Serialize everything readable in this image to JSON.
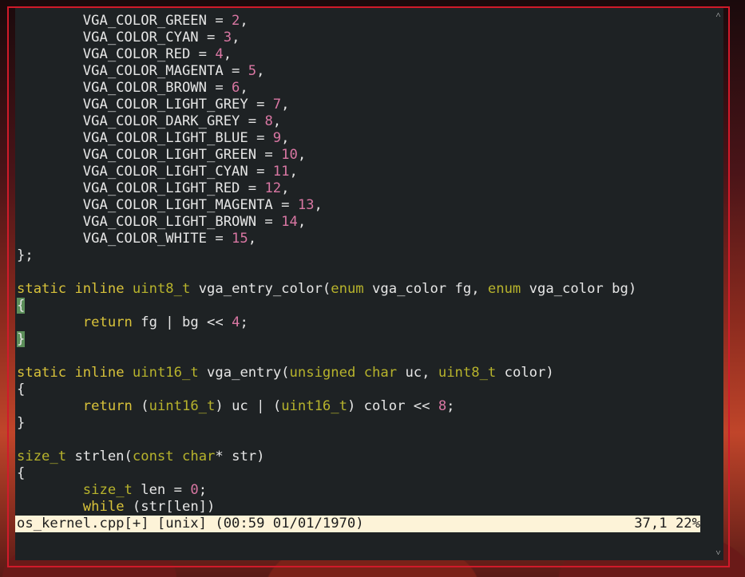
{
  "editor": {
    "code_lines": [
      [
        {
          "t": "        VGA_COLOR_GREEN = "
        },
        {
          "t": "2",
          "c": "num"
        },
        {
          "t": ","
        }
      ],
      [
        {
          "t": "        VGA_COLOR_CYAN = "
        },
        {
          "t": "3",
          "c": "num"
        },
        {
          "t": ","
        }
      ],
      [
        {
          "t": "        VGA_COLOR_RED = "
        },
        {
          "t": "4",
          "c": "num"
        },
        {
          "t": ","
        }
      ],
      [
        {
          "t": "        VGA_COLOR_MAGENTA = "
        },
        {
          "t": "5",
          "c": "num"
        },
        {
          "t": ","
        }
      ],
      [
        {
          "t": "        VGA_COLOR_BROWN = "
        },
        {
          "t": "6",
          "c": "num"
        },
        {
          "t": ","
        }
      ],
      [
        {
          "t": "        VGA_COLOR_LIGHT_GREY = "
        },
        {
          "t": "7",
          "c": "num"
        },
        {
          "t": ","
        }
      ],
      [
        {
          "t": "        VGA_COLOR_DARK_GREY = "
        },
        {
          "t": "8",
          "c": "num"
        },
        {
          "t": ","
        }
      ],
      [
        {
          "t": "        VGA_COLOR_LIGHT_BLUE = "
        },
        {
          "t": "9",
          "c": "num"
        },
        {
          "t": ","
        }
      ],
      [
        {
          "t": "        VGA_COLOR_LIGHT_GREEN = "
        },
        {
          "t": "10",
          "c": "num"
        },
        {
          "t": ","
        }
      ],
      [
        {
          "t": "        VGA_COLOR_LIGHT_CYAN = "
        },
        {
          "t": "11",
          "c": "num"
        },
        {
          "t": ","
        }
      ],
      [
        {
          "t": "        VGA_COLOR_LIGHT_RED = "
        },
        {
          "t": "12",
          "c": "num"
        },
        {
          "t": ","
        }
      ],
      [
        {
          "t": "        VGA_COLOR_LIGHT_MAGENTA = "
        },
        {
          "t": "13",
          "c": "num"
        },
        {
          "t": ","
        }
      ],
      [
        {
          "t": "        VGA_COLOR_LIGHT_BROWN = "
        },
        {
          "t": "14",
          "c": "num"
        },
        {
          "t": ","
        }
      ],
      [
        {
          "t": "        VGA_COLOR_WHITE = "
        },
        {
          "t": "15",
          "c": "num"
        },
        {
          "t": ","
        }
      ],
      [
        {
          "t": "};"
        }
      ],
      [],
      [
        {
          "t": "static",
          "c": "kw"
        },
        {
          "t": " "
        },
        {
          "t": "inline",
          "c": "kw"
        },
        {
          "t": " "
        },
        {
          "t": "uint8_t",
          "c": "ty"
        },
        {
          "t": " vga_entry_color("
        },
        {
          "t": "enum",
          "c": "ty"
        },
        {
          "t": " vga_color fg, "
        },
        {
          "t": "enum",
          "c": "ty"
        },
        {
          "t": " vga_color bg)"
        }
      ],
      [
        {
          "t": "{",
          "c": "brace-hl"
        }
      ],
      [
        {
          "t": "        "
        },
        {
          "t": "return",
          "c": "kw"
        },
        {
          "t": " fg | bg << "
        },
        {
          "t": "4",
          "c": "num"
        },
        {
          "t": ";"
        }
      ],
      [
        {
          "t": "}",
          "c": "brace-hl"
        }
      ],
      [],
      [
        {
          "t": "static",
          "c": "kw"
        },
        {
          "t": " "
        },
        {
          "t": "inline",
          "c": "kw"
        },
        {
          "t": " "
        },
        {
          "t": "uint16_t",
          "c": "ty"
        },
        {
          "t": " vga_entry("
        },
        {
          "t": "unsigned",
          "c": "ty"
        },
        {
          "t": " "
        },
        {
          "t": "char",
          "c": "ty"
        },
        {
          "t": " uc, "
        },
        {
          "t": "uint8_t",
          "c": "ty"
        },
        {
          "t": " color)"
        }
      ],
      [
        {
          "t": "{"
        }
      ],
      [
        {
          "t": "        "
        },
        {
          "t": "return",
          "c": "kw"
        },
        {
          "t": " ("
        },
        {
          "t": "uint16_t",
          "c": "ty"
        },
        {
          "t": ") uc | ("
        },
        {
          "t": "uint16_t",
          "c": "ty"
        },
        {
          "t": ") color << "
        },
        {
          "t": "8",
          "c": "num"
        },
        {
          "t": ";"
        }
      ],
      [
        {
          "t": "}"
        }
      ],
      [],
      [
        {
          "t": "size_t",
          "c": "ty"
        },
        {
          "t": " strlen("
        },
        {
          "t": "const",
          "c": "ty"
        },
        {
          "t": " "
        },
        {
          "t": "char",
          "c": "ty"
        },
        {
          "t": "* str)"
        }
      ],
      [
        {
          "t": "{"
        }
      ],
      [
        {
          "t": "        "
        },
        {
          "t": "size_t",
          "c": "ty"
        },
        {
          "t": " len = "
        },
        {
          "t": "0",
          "c": "num"
        },
        {
          "t": ";"
        }
      ],
      [
        {
          "t": "        "
        },
        {
          "t": "while",
          "c": "kw"
        },
        {
          "t": " (str[len])"
        }
      ]
    ]
  },
  "status": {
    "left": "os_kernel.cpp[+] [unix] (00:59 01/01/1970)",
    "position": "37,1",
    "percent": "22%"
  },
  "scrollbar": {
    "up_icon": "chevron-up-icon",
    "down_icon": "chevron-down-icon",
    "up_glyph": "˄",
    "down_glyph": "˅"
  },
  "colors": {
    "background": "#1e2224",
    "keyword": "#d8c23a",
    "type": "#b7b32c",
    "number": "#d977a3",
    "brace_highlight": "#5c8f5a",
    "statusbar_bg": "#fdf3d8",
    "frame": "#d11a2a"
  }
}
